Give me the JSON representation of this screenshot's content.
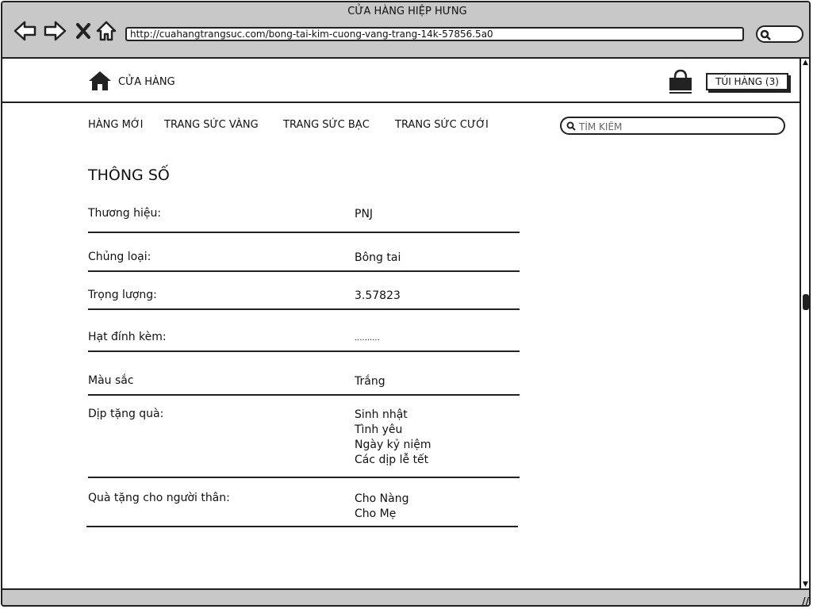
{
  "browser": {
    "title": "CỬA HÀNG HIỆP HƯNG",
    "url": "http://cuahangtrangsuc.com/bong-tai-kim-cuong-vang-trang-14k-57856.5a0"
  },
  "header": {
    "store_name": "CỬA HÀNG",
    "cart_label": "TÚI HÀNG (3)"
  },
  "menu": {
    "items": [
      "HÀNG MỚI",
      "TRANG SỨC VÀNG",
      "TRANG SỨC BẠC",
      "TRANG SỨC CƯỚI"
    ],
    "search_placeholder": "TÌM KIẾM"
  },
  "specs": {
    "title": "THÔNG SỐ",
    "rows": [
      {
        "label": "Thương hiệu:",
        "values": [
          "PNJ"
        ]
      },
      {
        "label": "Chủng loại:",
        "values": [
          "Bông tai"
        ]
      },
      {
        "label": "Trọng lượng:",
        "values": [
          "3.57823"
        ]
      },
      {
        "label": "Hạt đính kèm:",
        "values": [
          ".........."
        ]
      },
      {
        "label": "Màu sắc",
        "values": [
          "Trắng"
        ]
      },
      {
        "label": "Dịp tặng quà:",
        "values": [
          "Sinh nhật",
          "Tình yêu",
          "Ngày kỷ niệm",
          "Các dịp lễ tết"
        ]
      },
      {
        "label": "Quà tặng cho người thân:",
        "values": [
          "Cho Nàng",
          "Cho Mẹ"
        ]
      }
    ]
  }
}
